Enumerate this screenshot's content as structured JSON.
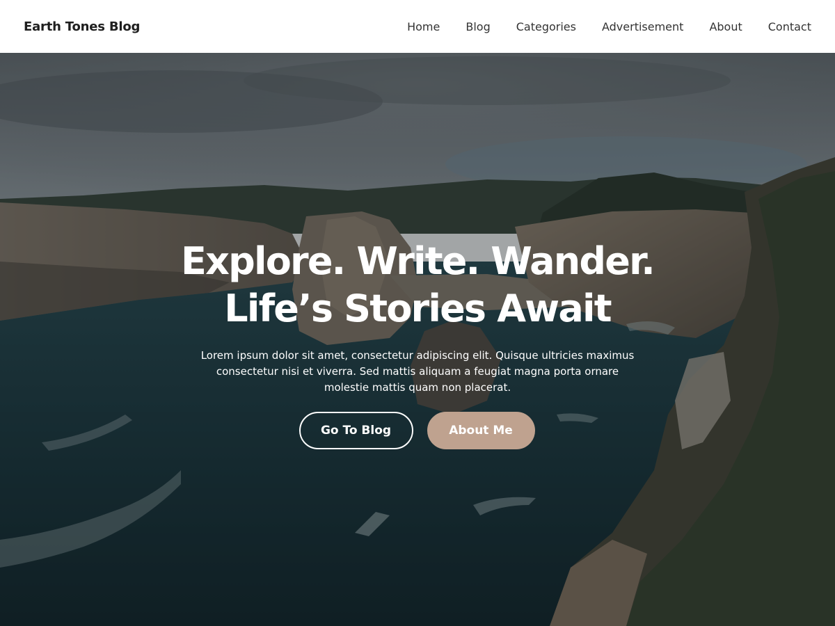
{
  "header": {
    "site_title": "Earth Tones Blog",
    "nav": [
      "Home",
      "Blog",
      "Categories",
      "Advertisement",
      "About",
      "Contact"
    ]
  },
  "hero": {
    "title_line1": "Explore. Write. Wander.",
    "title_line2": "Life’s Stories Await",
    "text": "Lorem ipsum dolor sit amet, consectetur adipiscing elit. Quisque ultricies maximus consectetur nisi et viverra. Sed mattis aliquam a feugiat magna porta ornare molestie mattis quam non placerat.",
    "primary_button": "Go To Blog",
    "secondary_button": "About Me",
    "background": "coastal-cliffs-photo"
  },
  "colors": {
    "header_bg": "#ffffff",
    "accent": "#bfa28f",
    "text_dark": "#1f1f1f",
    "nav_text": "#333333"
  }
}
